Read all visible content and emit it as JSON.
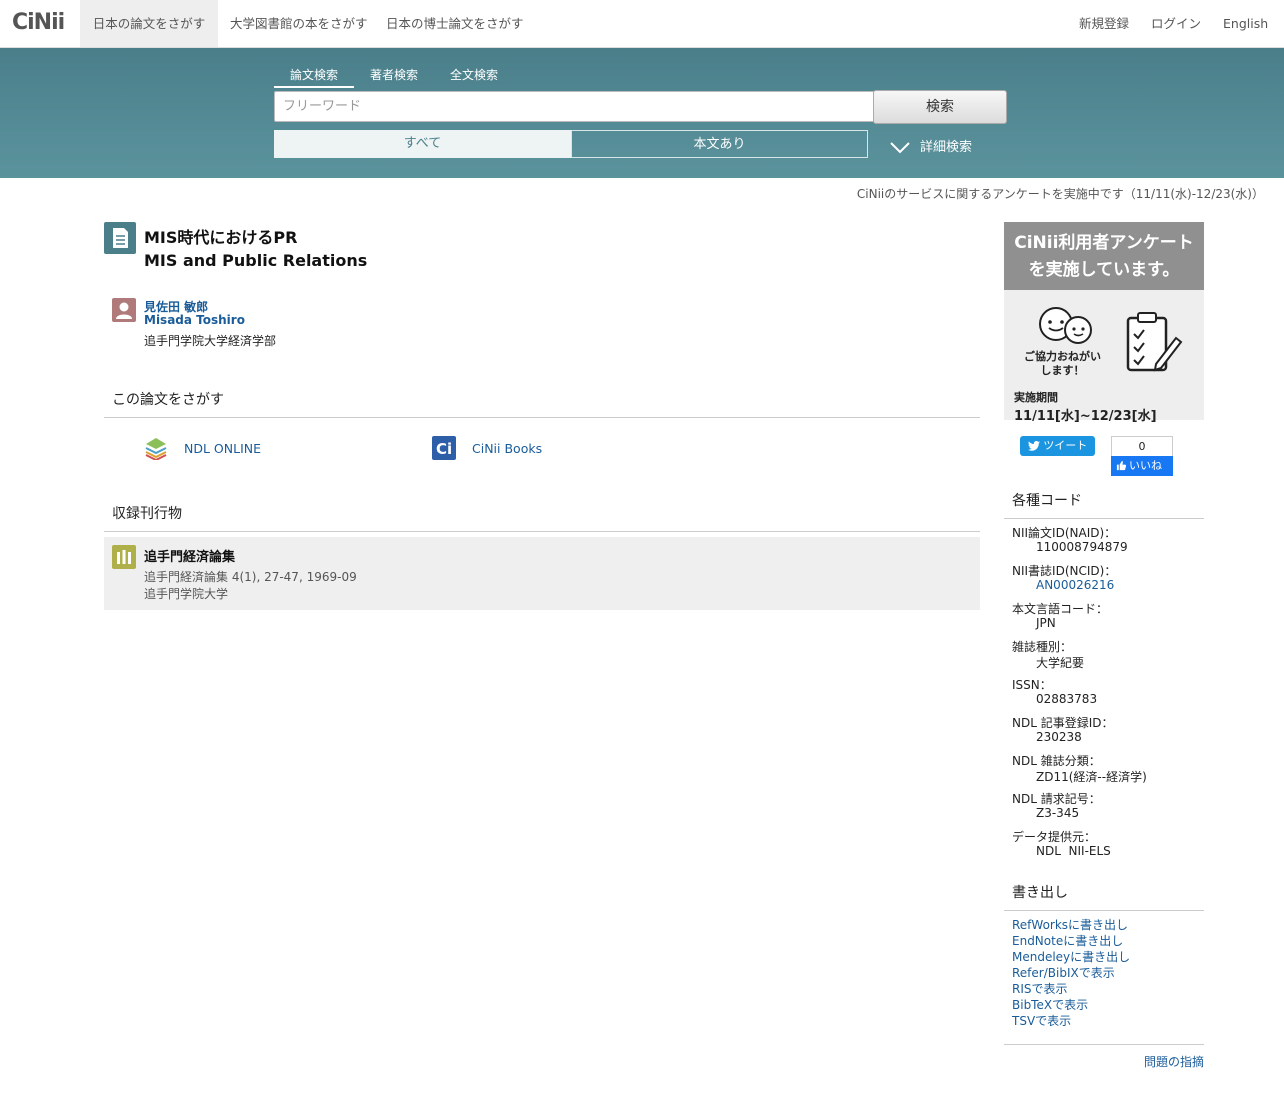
{
  "topnav": {
    "logo": "CiNii",
    "tabs": [
      "日本の論文をさがす",
      "大学図書館の本をさがす",
      "日本の博士論文をさがす"
    ],
    "right": [
      "新規登録",
      "ログイン",
      "English"
    ]
  },
  "search": {
    "tabs": [
      "論文検索",
      "著者検索",
      "全文検索"
    ],
    "placeholder": "フリーワード",
    "button": "検索",
    "filter_all": "すべて",
    "filter_fulltext": "本文あり",
    "advanced": "詳細検索"
  },
  "survey_note": "CiNiiのサービスに関するアンケートを実施中です（11/11(水)-12/23(水)）",
  "article": {
    "title_ja": "MIS時代におけるPR",
    "title_en": "MIS and Public Relations",
    "author_ja": "見佐田 敏郎",
    "author_en": "Misada Toshiro",
    "affiliation": "追手門学院大学経済学部"
  },
  "find_section": {
    "heading": "この論文をさがす",
    "links": [
      "NDL ONLINE",
      "CiNii Books"
    ]
  },
  "journal_section": {
    "heading": "収録刊行物",
    "title": "追手門経済論集",
    "citation": "追手門経済論集 4(1), 27-47, 1969-09",
    "publisher": "追手門学院大学"
  },
  "banner": {
    "line1": "CiNii利用者アンケート",
    "line2": "を実施しています。",
    "thanks1": "ご協力おねがい",
    "thanks2": "します！",
    "period_label": "実施期間",
    "period": "11/11[水]~12/23[水]"
  },
  "social": {
    "tweet": "ツイート",
    "like_count": "0",
    "like": "いいね"
  },
  "codes": {
    "heading": "各種コード",
    "items": [
      {
        "label": "NII論文ID(NAID)：",
        "value": "110008794879"
      },
      {
        "label": "NII書誌ID(NCID)：",
        "value": "AN00026216"
      },
      {
        "label": "本文言語コード：",
        "value": "JPN"
      },
      {
        "label": "雑誌種別：",
        "value": "大学紀要"
      },
      {
        "label": "ISSN：",
        "value": "02883783"
      },
      {
        "label": "NDL 記事登録ID：",
        "value": "230238"
      },
      {
        "label": "NDL 雑誌分類：",
        "value": "ZD11(経済--経済学)"
      },
      {
        "label": "NDL 請求記号：",
        "value": "Z3-345"
      },
      {
        "label": "データ提供元：",
        "value": "NDL  NII-ELS"
      }
    ]
  },
  "export": {
    "heading": "書き出し",
    "items": [
      "RefWorksに書き出し",
      "EndNoteに書き出し",
      "Mendeleyに書き出し",
      "Refer/BibIXで表示",
      "RISで表示",
      "BibTeXで表示",
      "TSVで表示"
    ]
  },
  "report": "問題の指摘",
  "colors": {
    "band": "#4a7f8a",
    "link": "#1a5c99"
  }
}
